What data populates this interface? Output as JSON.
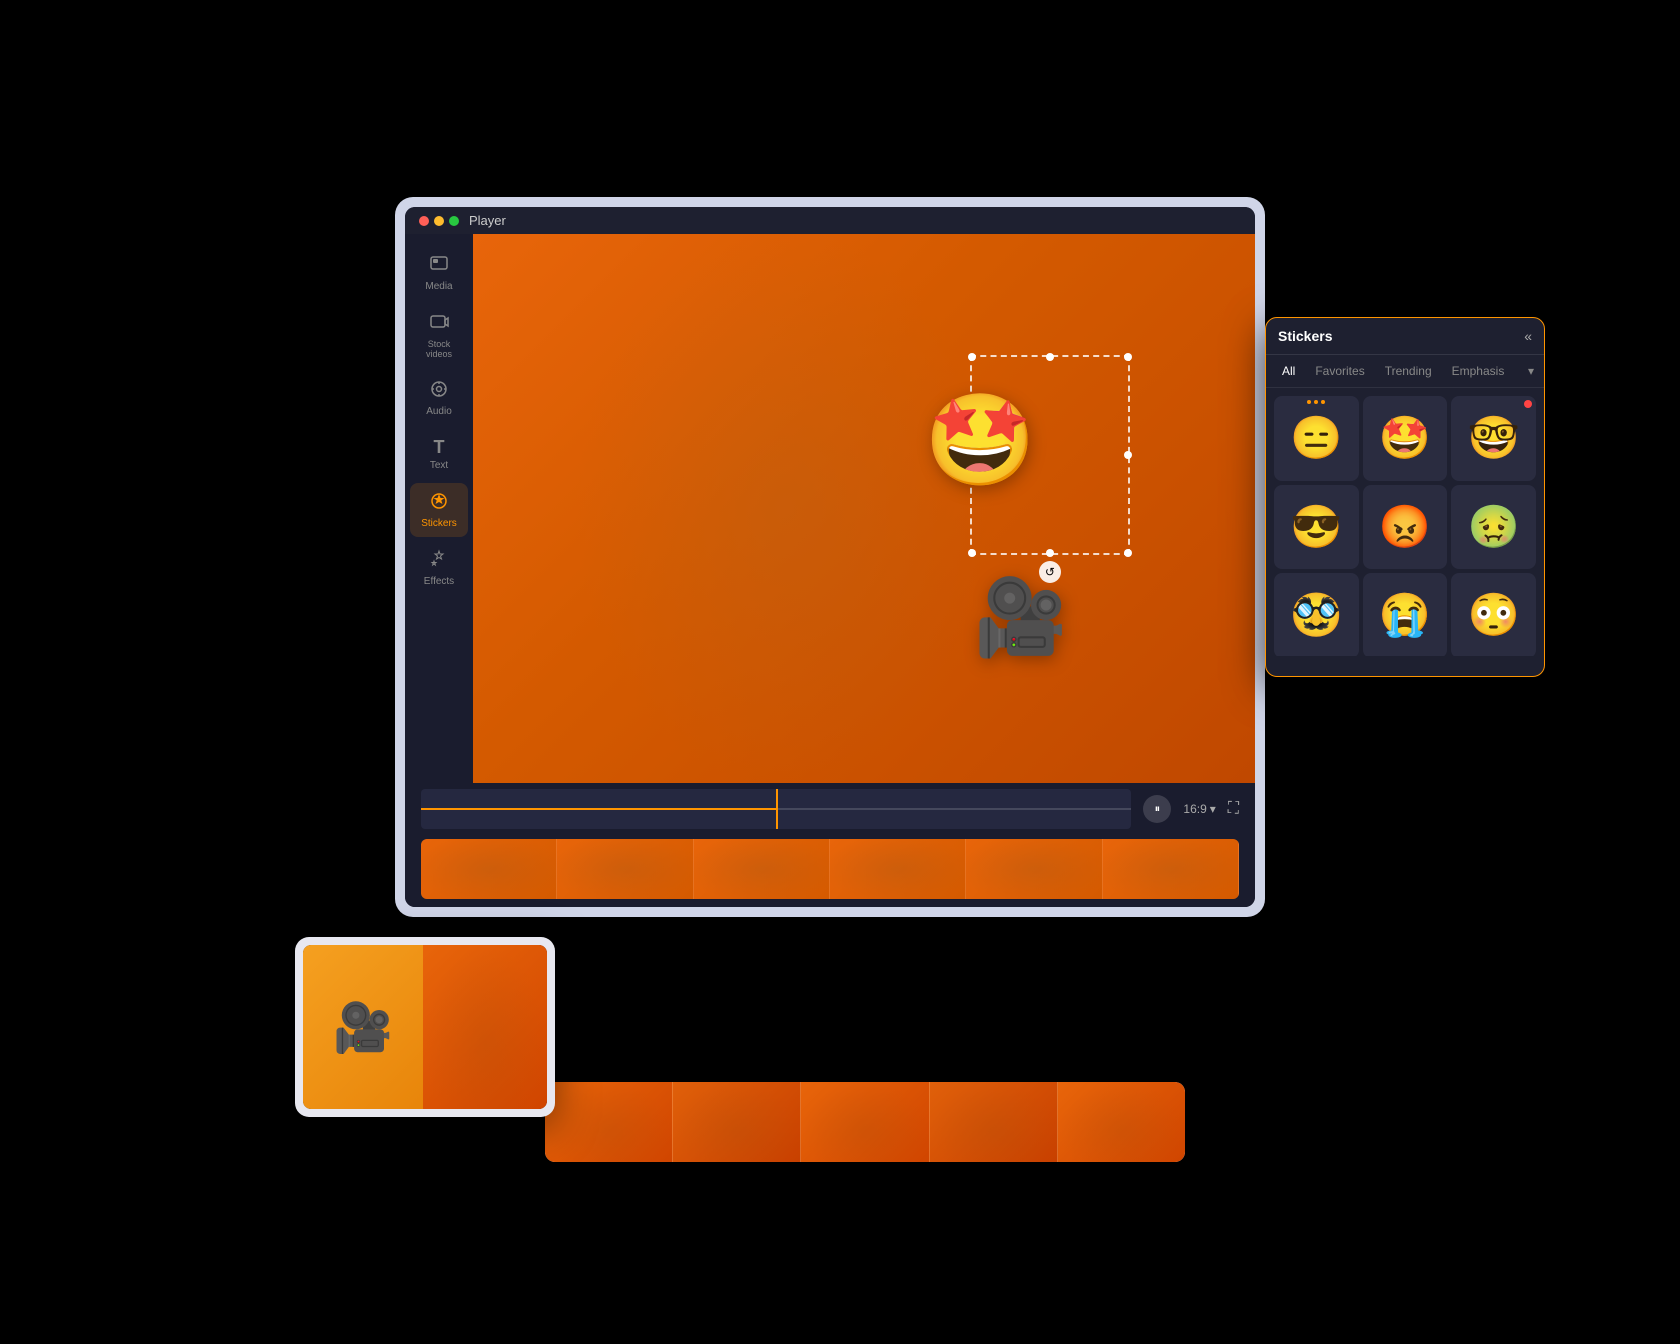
{
  "title": "Player",
  "window_dots": [
    "red",
    "yellow",
    "green"
  ],
  "sidebar": {
    "items": [
      {
        "label": "Media",
        "icon": "🖼",
        "active": false
      },
      {
        "label": "Stock\nvideos",
        "icon": "📽",
        "active": false
      },
      {
        "label": "Audio",
        "icon": "🎵",
        "active": false
      },
      {
        "label": "Text",
        "icon": "T",
        "active": false
      },
      {
        "label": "Stickers",
        "icon": "⭐",
        "active": true
      },
      {
        "label": "Effects",
        "icon": "✨",
        "active": false
      }
    ]
  },
  "stickers_panel": {
    "title": "Stickers",
    "collapse_icon": "«",
    "tabs": [
      {
        "label": "All",
        "active": true
      },
      {
        "label": "Favorites",
        "active": false
      },
      {
        "label": "Trending",
        "active": false
      },
      {
        "label": "Emphasis",
        "active": false
      }
    ],
    "stickers": [
      {
        "emoji": "😑",
        "dots": true
      },
      {
        "emoji": "🤩",
        "dots": false
      },
      {
        "emoji": "🤓",
        "dots": false
      },
      {
        "emoji": "😎",
        "dots": false
      },
      {
        "emoji": "😡",
        "dots": false
      },
      {
        "emoji": "🤢",
        "dots": false
      },
      {
        "emoji": "🥸",
        "dots": false
      },
      {
        "emoji": "😭",
        "dots": false
      },
      {
        "emoji": "😳",
        "dots": false
      }
    ]
  },
  "player": {
    "sticker_emoji": "🤩",
    "camera_emoji": "🎥",
    "aspect_ratio": "16:9",
    "play_icon": "⏸"
  },
  "mobile": {
    "sticker_emoji": "🎥"
  },
  "timeline": {
    "frame_count": 6
  }
}
